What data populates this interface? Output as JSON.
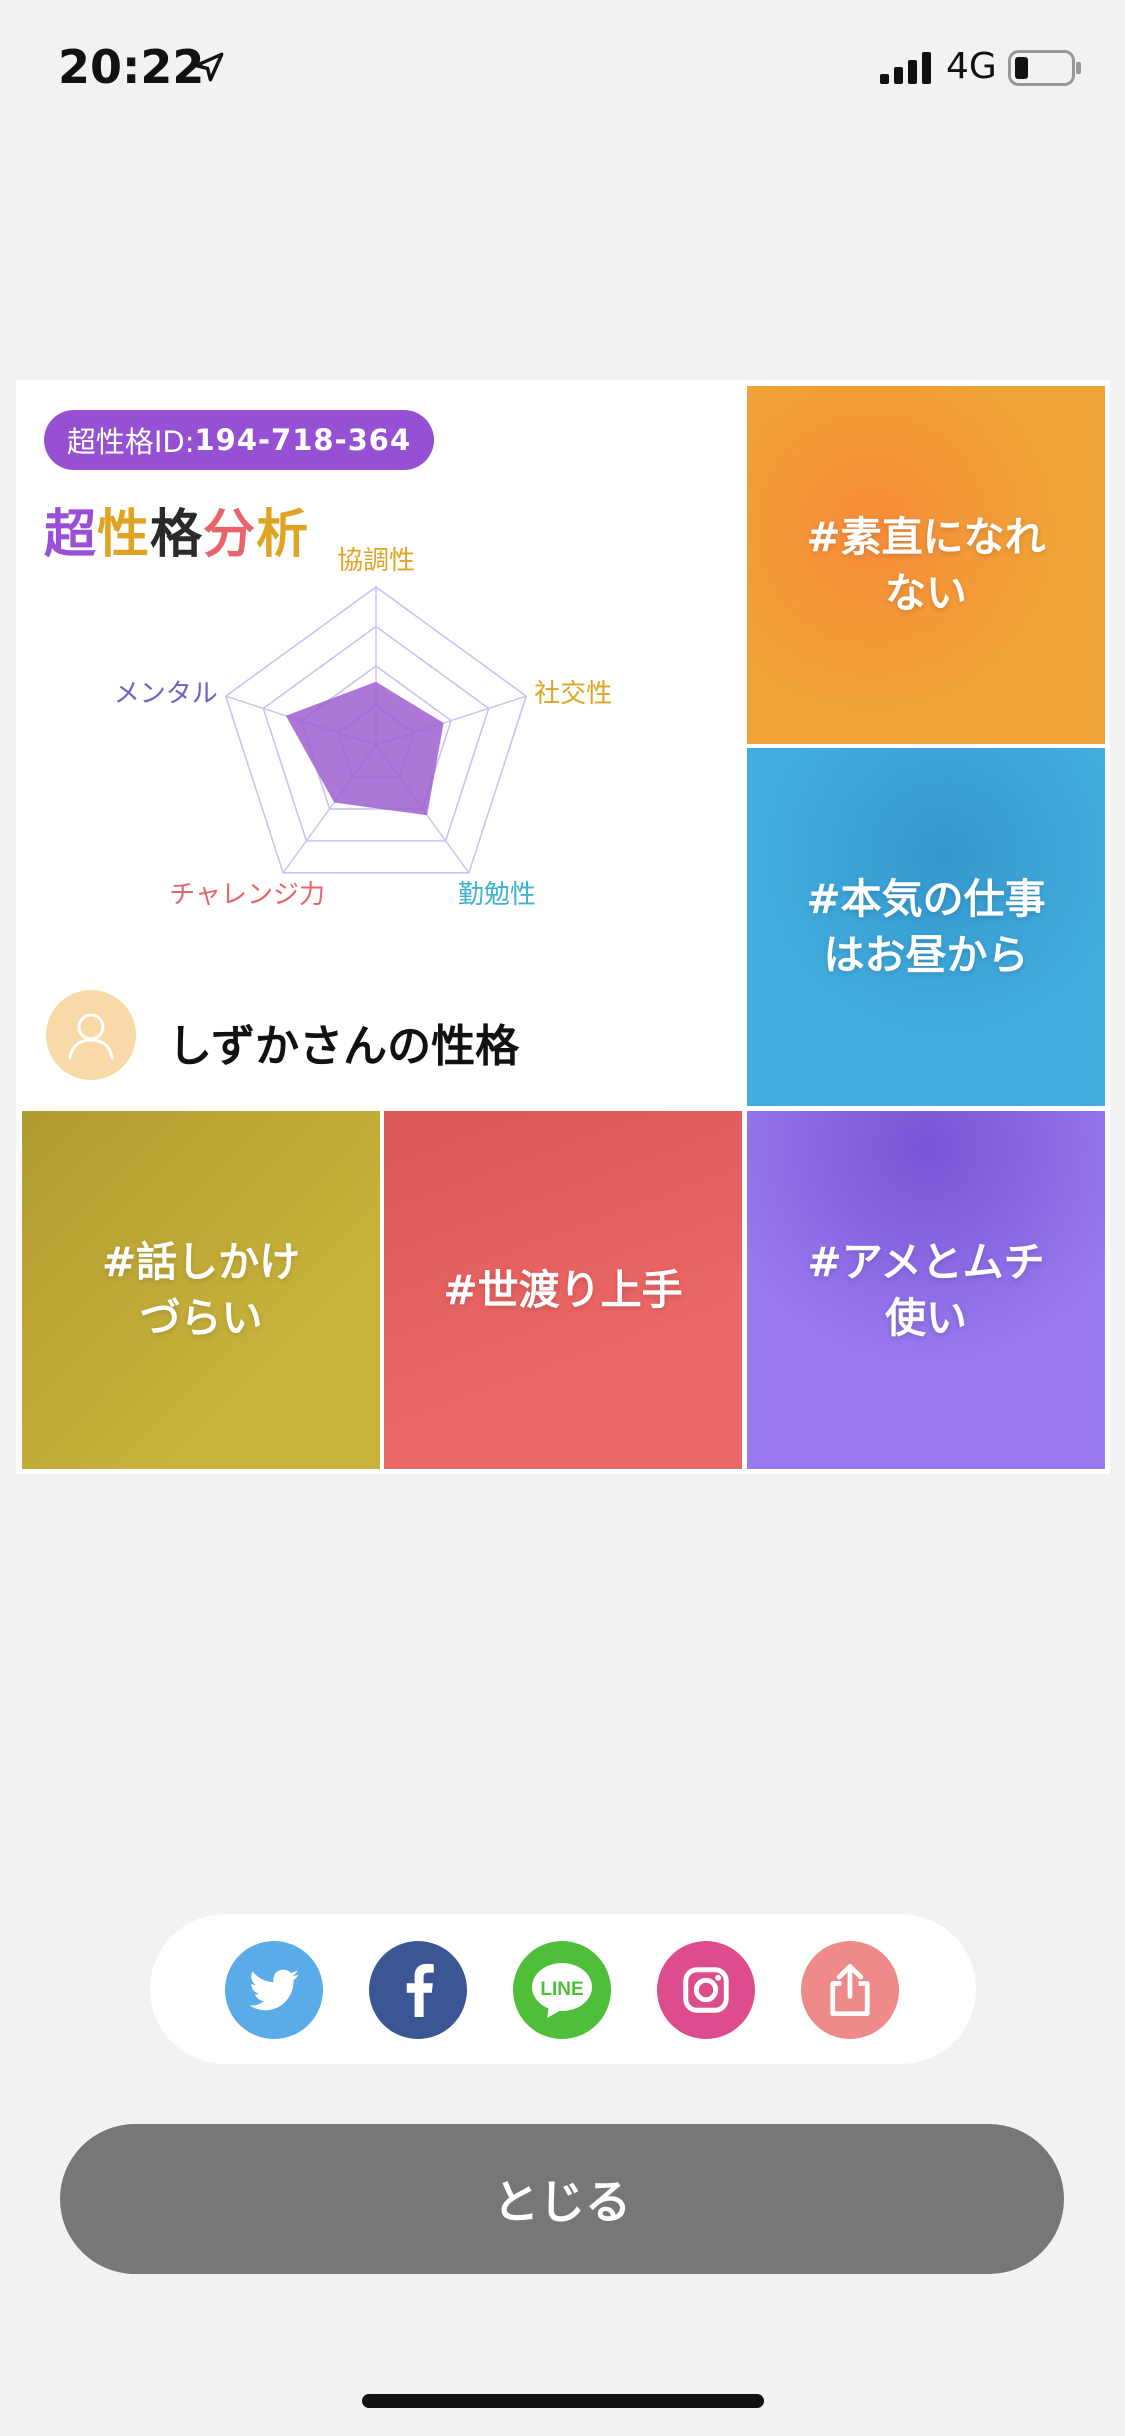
{
  "status_bar": {
    "time": "20:22",
    "network": "4G",
    "icons": [
      "location-arrow-icon",
      "signal-icon",
      "battery-icon"
    ]
  },
  "card": {
    "id_label": "超性格ID:",
    "id_value": "194-718-364",
    "logo": [
      "超",
      "性",
      "格",
      "分",
      "析"
    ],
    "owner_title": "しずかさんの性格",
    "radar": {
      "axes": [
        "協調性",
        "社交性",
        "勤勉性",
        "チャレンジ力",
        "メンタル"
      ],
      "axis_colors": [
        "#e0a425",
        "#e0a425",
        "#3fb3cf",
        "#e8646a",
        "#6a63c8"
      ],
      "values": [
        0.4,
        0.45,
        0.55,
        0.45,
        0.6
      ],
      "fill": "#9f5fd0"
    },
    "tags": [
      {
        "text": "#素直になれ\nない",
        "color": "#f0a437"
      },
      {
        "text": "#本気の仕事\nはお昼から",
        "color": "#42aee0"
      },
      {
        "text": "#話しかけ\nづらい",
        "color": "#c9b33c"
      },
      {
        "text": "#世渡り上手",
        "color": "#ec6866"
      },
      {
        "text": "#アメとムチ\n使い",
        "color": "#9a7af0"
      }
    ]
  },
  "share": {
    "buttons": [
      {
        "name": "twitter",
        "icon": "twitter-icon",
        "color": "#5aace8"
      },
      {
        "name": "facebook",
        "icon": "facebook-icon",
        "color": "#3b5695"
      },
      {
        "name": "line",
        "icon": "line-icon",
        "label": "LINE",
        "color": "#4fbf3a"
      },
      {
        "name": "instagram",
        "icon": "instagram-icon",
        "color": "#dd4c8d"
      },
      {
        "name": "share",
        "icon": "share-icon",
        "color": "#ef8a8a"
      }
    ]
  },
  "close_label": "とじる"
}
